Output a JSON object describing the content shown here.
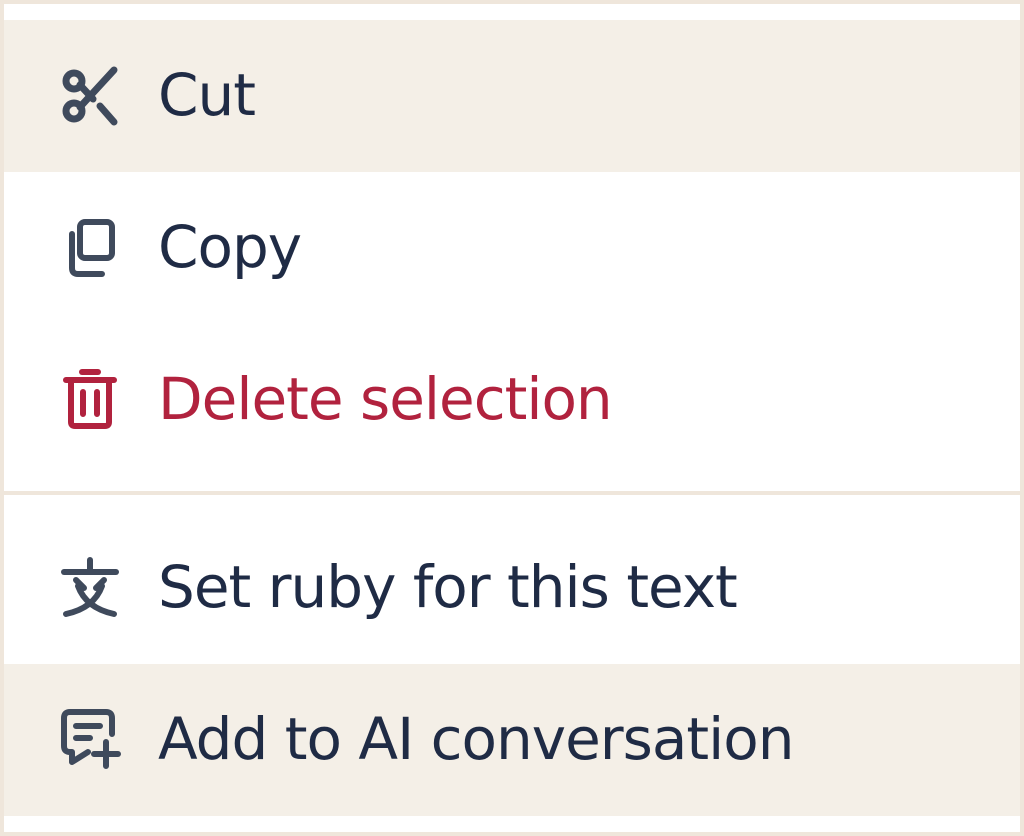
{
  "colors": {
    "text": "#1f2b45",
    "icon": "#3f4a5c",
    "danger": "#b1223e",
    "hover_bg": "#f4efe7",
    "border": "#efe6db"
  },
  "menu": {
    "items": [
      {
        "label": "Cut",
        "icon": "scissors-icon",
        "state": "highlighted"
      },
      {
        "label": "Copy",
        "icon": "copy-icon"
      },
      {
        "label": "Delete selection",
        "icon": "trash-icon",
        "variant": "danger"
      },
      {
        "label": "Set ruby for this text",
        "icon": "ruby-text-icon"
      },
      {
        "label": "Add to AI conversation",
        "icon": "chat-add-icon",
        "state": "highlighted"
      }
    ]
  }
}
